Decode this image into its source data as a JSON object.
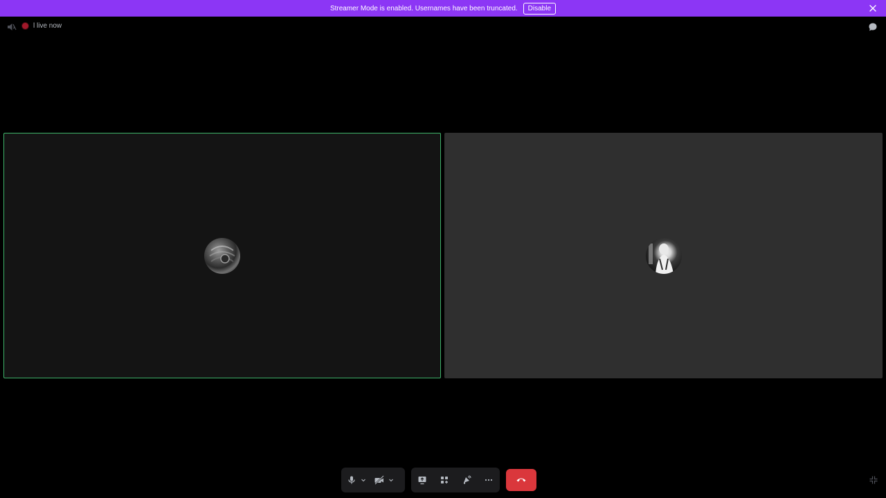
{
  "banner": {
    "message": "Streamer Mode is enabled. Usernames have been truncated.",
    "disable_label": "Disable",
    "close_icon": "close-icon",
    "color": "#8c36f5"
  },
  "topbar": {
    "speaker_icon": "speaker-icon",
    "live_indicator_color": "#a0182a",
    "channel_label": "l live now",
    "chat_icon": "chat-bubble-icon"
  },
  "tiles": [
    {
      "participant": "participant-1",
      "speaking": true,
      "background": "#141414",
      "outline_color": "#3fb46a"
    },
    {
      "participant": "participant-2",
      "speaking": false,
      "background": "#2f2f2f"
    }
  ],
  "controls": {
    "mic_icon": "microphone-icon",
    "camera_icon": "camera-off-icon",
    "screenshare_icon": "screen-share-icon",
    "activities_icon": "activities-icon",
    "soundboard_icon": "soundboard-icon",
    "more_icon": "more-icon",
    "hangup_icon": "hang-up-icon",
    "hangup_color": "#da373c",
    "fullscreen_icon": "exit-fullscreen-icon"
  }
}
